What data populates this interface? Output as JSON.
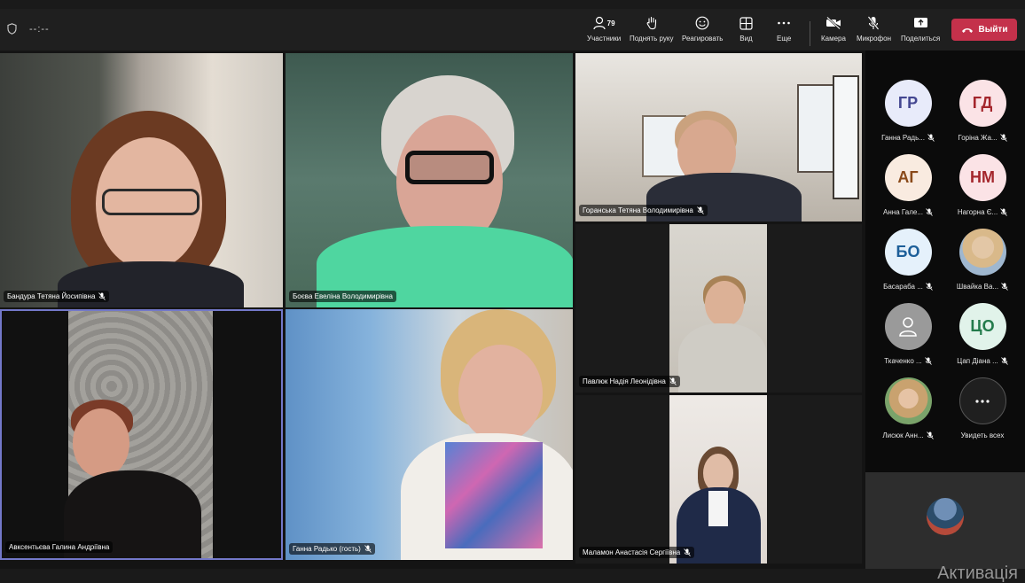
{
  "window": {
    "title": ""
  },
  "toolbar": {
    "timer": "--:--",
    "participants": {
      "label": "Участники",
      "count": "79"
    },
    "raise_hand": {
      "label": "Поднять руку"
    },
    "react": {
      "label": "Реагировать"
    },
    "view": {
      "label": "Вид"
    },
    "more": {
      "label": "Еще"
    },
    "camera": {
      "label": "Камера"
    },
    "mic": {
      "label": "Микрофон"
    },
    "share": {
      "label": "Поделиться"
    },
    "leave": {
      "label": "Выйти",
      "color": "#c4314b"
    }
  },
  "video_tiles": [
    {
      "name": "Бандура Тетяна Йосипівна"
    },
    {
      "name": "Боєва Евеліна Володимирівна"
    },
    {
      "name": "Горанська Тетяна Володимирівна"
    },
    {
      "name": "Авксентьєва Галина Андріївна"
    },
    {
      "name": "Ганна Радько (гость)"
    },
    {
      "name": "Павлюк Надія Леонідівна"
    },
    {
      "name": "Маламон Анастасія Сергіївна"
    }
  ],
  "roster": [
    {
      "initials": "ГР",
      "name": "Ганна Радь...",
      "avatar_bg": "#e8ebfa",
      "text_color": "#444791"
    },
    {
      "initials": "ГД",
      "name": "Горіна Жа...",
      "avatar_bg": "#fbe3e6",
      "text_color": "#a4262c"
    },
    {
      "initials": "АГ",
      "name": "Анна Гале...",
      "avatar_bg": "#f9ebe0",
      "text_color": "#8a4a1a"
    },
    {
      "initials": "НМ",
      "name": "Нагорна Є...",
      "avatar_bg": "#fbe3e6",
      "text_color": "#a4262c"
    },
    {
      "initials": "БО",
      "name": "Басараба ...",
      "avatar_bg": "#e5f1fb",
      "text_color": "#1d5f99"
    },
    {
      "initials": "",
      "name": "Швайка Ва...",
      "avatar_bg": "#c9b8a0",
      "text_color": "#ffffff"
    },
    {
      "initials": "",
      "name": "Ткаченко ...",
      "avatar_bg": "#9a9a9a",
      "text_color": "#ffffff"
    },
    {
      "initials": "ЦО",
      "name": "Цап Діана ...",
      "avatar_bg": "#e1f3ea",
      "text_color": "#237b4b"
    },
    {
      "initials": "",
      "name": "Лисюк Анн...",
      "avatar_bg": "#b7a08a",
      "text_color": "#ffffff"
    },
    {
      "initials": "",
      "name": "Увидеть всех",
      "avatar_bg": "#1f1f1f",
      "text_color": "#ffffff"
    }
  ],
  "watermark": "Активація"
}
